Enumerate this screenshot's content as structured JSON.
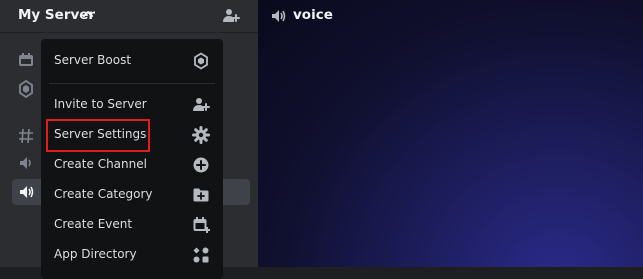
{
  "server": {
    "name": "My Server"
  },
  "channel": {
    "title": "voice"
  },
  "menu": {
    "items": [
      {
        "label": "Server Boost",
        "icon": "boost-icon"
      },
      {
        "label": "Invite to Server",
        "icon": "add-member-icon"
      },
      {
        "label": "Server Settings",
        "icon": "gear-icon",
        "highlighted": true
      },
      {
        "label": "Create Channel",
        "icon": "plus-circle-icon"
      },
      {
        "label": "Create Category",
        "icon": "folder-plus-icon"
      },
      {
        "label": "Create Event",
        "icon": "calendar-plus-icon"
      },
      {
        "label": "App Directory",
        "icon": "app-directory-icon"
      }
    ]
  },
  "colors": {
    "highlight": "#e21b1b",
    "menu_bg": "#111214",
    "sidebar_bg": "#2b2d31"
  }
}
